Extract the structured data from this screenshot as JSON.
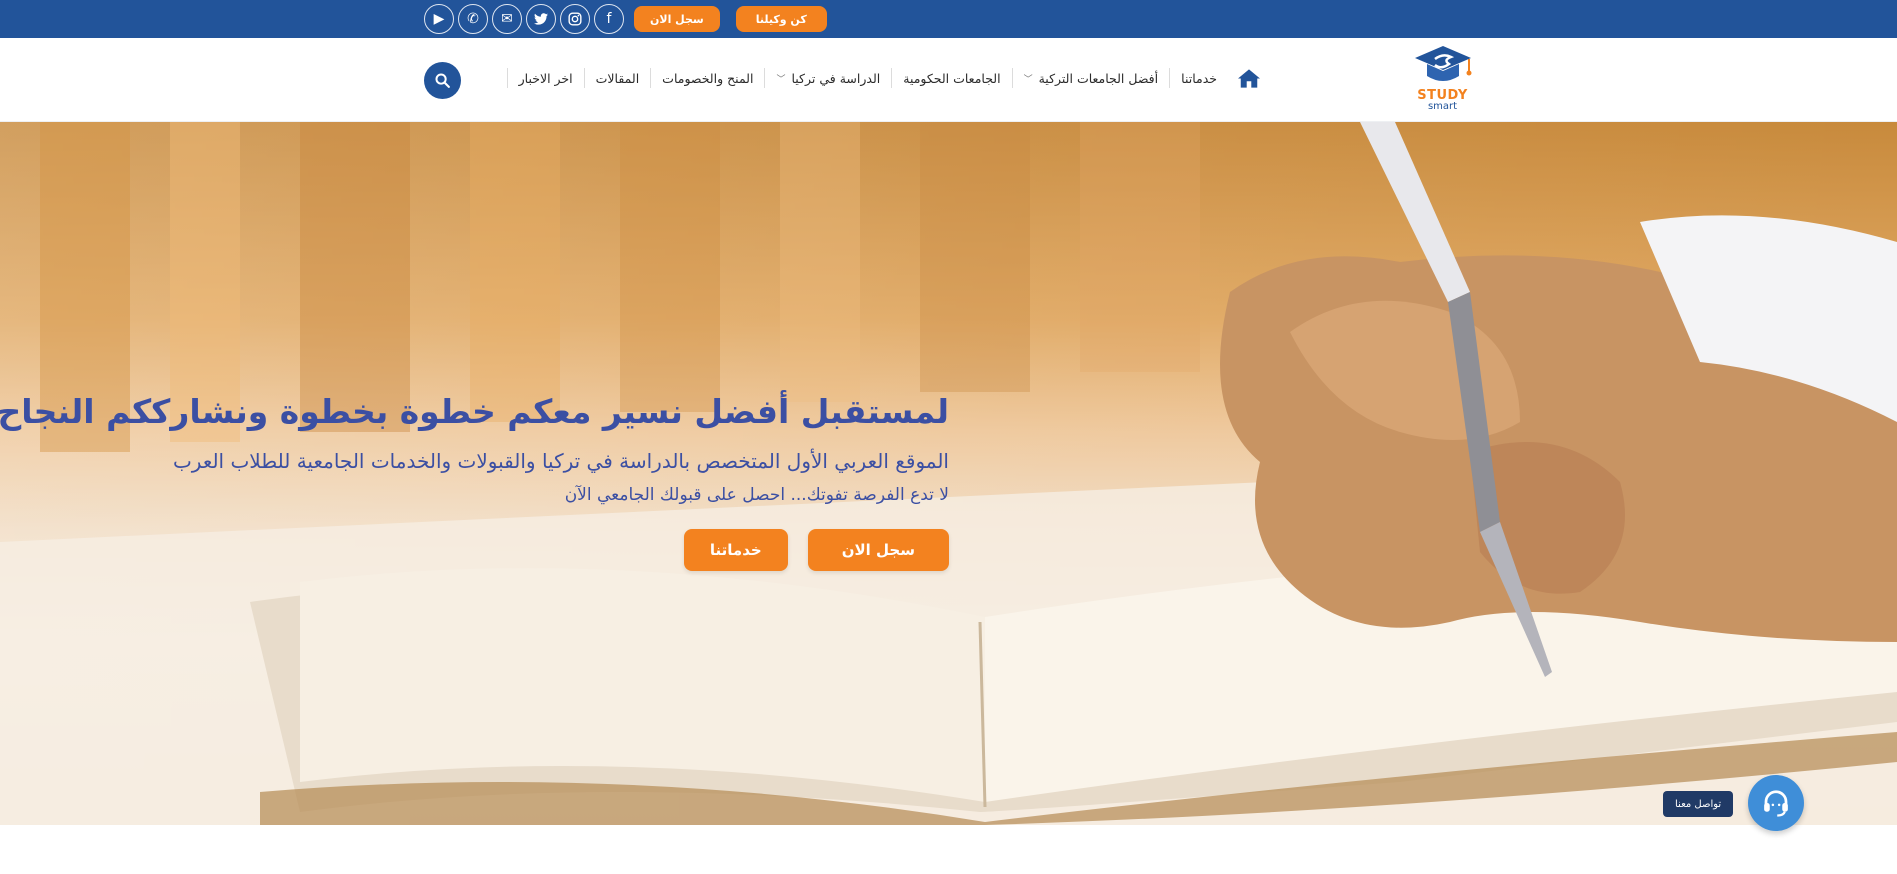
{
  "topbar": {
    "social": [
      {
        "icon": "youtube-icon",
        "glyph": "▶"
      },
      {
        "icon": "phone-icon",
        "glyph": "✆"
      },
      {
        "icon": "email-icon",
        "glyph": "✉"
      },
      {
        "icon": "twitter-icon",
        "glyph": "🐦"
      },
      {
        "icon": "instagram-icon",
        "glyph": "◎"
      },
      {
        "icon": "facebook-icon",
        "glyph": "f"
      }
    ],
    "register_label": "سجل الان",
    "agent_label": "كن وكيلنا"
  },
  "header": {
    "logo_study": "STUDY",
    "logo_smart": "smart",
    "nav": [
      {
        "label": "خدماتنا",
        "dropdown": false
      },
      {
        "label": "أفضل الجامعات التركية",
        "dropdown": true
      },
      {
        "label": "الجامعات الحكومية",
        "dropdown": false
      },
      {
        "label": "الدراسة في تركيا",
        "dropdown": true
      },
      {
        "label": "المنح والخصومات",
        "dropdown": false
      },
      {
        "label": "المقالات",
        "dropdown": false
      },
      {
        "label": "اخر الاخبار",
        "dropdown": false
      }
    ]
  },
  "hero": {
    "title": "لمستقبل أفضل نسير معكم خطوة بخطوة ونشارككم النجاح",
    "subtitle": "الموقع العربي الأول المتخصص بالدراسة في تركيا والقبولات والخدمات الجامعية للطلاب العرب",
    "tagline": "لا تدع الفرصة تفوتك... احصل على قبولك الجامعي الآن",
    "register_button": "سجل الان",
    "services_button": "خدماتنا"
  },
  "chat": {
    "label": "تواصل معنا"
  },
  "colors": {
    "primary": "#22549a",
    "accent": "#f3821f",
    "hero_text": "#3b4fa3"
  }
}
